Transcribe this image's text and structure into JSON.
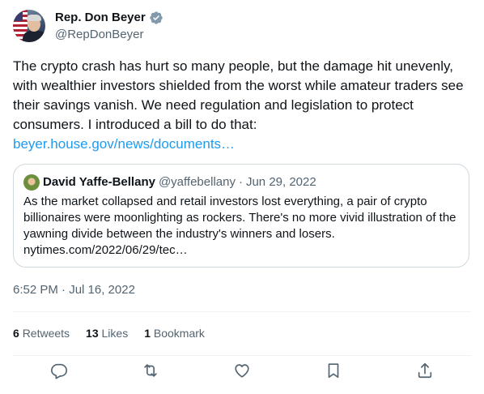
{
  "author": {
    "display_name": "Rep. Don Beyer",
    "handle": "@RepDonBeyer",
    "verified_icon": "verified-badge-icon"
  },
  "tweet": {
    "text": "The crypto crash has hurt so many people, but the damage hit unevenly, with wealthier investors shielded from the worst while amateur traders see their savings vanish. We need regulation and legislation to protect consumers. I introduced a bill to do that:",
    "link_text": "beyer.house.gov/news/documents…",
    "timestamp": "6:52 PM · Jul 16, 2022"
  },
  "quote": {
    "display_name": "David Yaffe-Bellany",
    "handle": "@yaffebellany",
    "separator": "·",
    "date": "Jun 29, 2022",
    "text": "As the market collapsed and retail investors lost everything, a pair of crypto billionaires were moonlighting as rockers. There's no more vivid illustration of the yawning divide between the industry's winners and losers.",
    "link_text": "nytimes.com/2022/06/29/tec…"
  },
  "stats": {
    "retweets_count": "6",
    "retweets_label": "Retweets",
    "likes_count": "13",
    "likes_label": "Likes",
    "bookmarks_count": "1",
    "bookmarks_label": "Bookmark"
  },
  "actions": [
    "reply-icon",
    "retweet-icon",
    "like-icon",
    "bookmark-icon",
    "share-icon"
  ],
  "colors": {
    "link": "#1d9bf0",
    "verified": "#829aab",
    "secondary_text": "#536471",
    "border": "#cfd9de"
  }
}
